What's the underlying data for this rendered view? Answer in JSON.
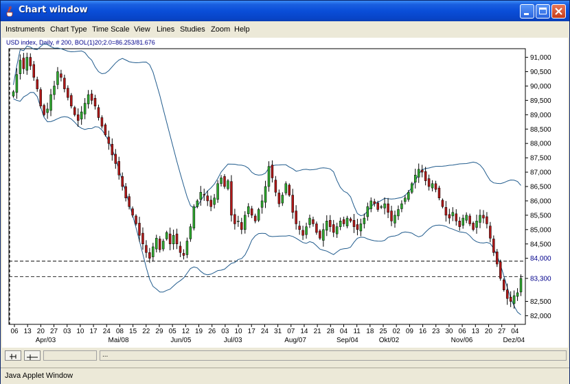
{
  "window": {
    "title": "Chart window",
    "status_text": "Java Applet Window"
  },
  "menu": {
    "items": [
      "Instruments",
      "Chart Type",
      "Time Scale",
      "View",
      "Lines",
      "Studies",
      "Zoom",
      "Help"
    ]
  },
  "chart_header": {
    "instrument": "USD index",
    "label": "USD index, Daily, # 200, BOL(1)20;2.0=86.253/81.676"
  },
  "status_bar": {
    "field2_text": "..."
  },
  "colors": {
    "up_candle": "#2ea82e",
    "down_candle": "#b01818",
    "bands": "#1f5a8c",
    "axis_text_blue": "#00008b",
    "title_gradient": "#0a4ed8"
  },
  "chart_data": {
    "type": "candlestick",
    "title": "USD index, Daily, # 200, BOL(1)20;2.0=86.253/81.676",
    "ylim": [
      81700,
      91300
    ],
    "y_ticks": [
      91000,
      90500,
      90000,
      89500,
      89000,
      88500,
      88000,
      87500,
      87000,
      86500,
      86000,
      85500,
      85000,
      84500,
      84000,
      83300,
      82500,
      82000
    ],
    "y_tick_labels": [
      "91,000",
      "90,500",
      "90,000",
      "89,500",
      "89,000",
      "88,500",
      "88,000",
      "87,500",
      "87,000",
      "86,500",
      "86,000",
      "85,500",
      "85,000",
      "84,500",
      "84,000",
      "83,300",
      "82,500",
      "82,000"
    ],
    "x_tick_labels": [
      "06",
      "13",
      "20",
      "27",
      "03",
      "10",
      "17",
      "24",
      "08",
      "15",
      "22",
      "29",
      "05",
      "12",
      "19",
      "26",
      "03",
      "10",
      "17",
      "24",
      "31",
      "07",
      "14",
      "21",
      "28",
      "04",
      "11",
      "18",
      "25",
      "02",
      "09",
      "16",
      "23",
      "30",
      "06",
      "13",
      "20",
      "27",
      "04"
    ],
    "month_labels": [
      "Apr/03",
      "Mai/08",
      "Jun/05",
      "Jul/03",
      "Aug/07",
      "Sep/04",
      "Okt/02",
      "Nov/06",
      "Dez/04"
    ],
    "horizontal_lines": [
      83900,
      83360
    ],
    "bollinger": {
      "period": 20,
      "std": 2.0,
      "upper_last": 86253,
      "lower_last": 81676
    },
    "close": [
      89800,
      90400,
      90900,
      90600,
      91000,
      90700,
      90300,
      89900,
      89300,
      89000,
      89200,
      89700,
      90000,
      90500,
      90300,
      89900,
      89600,
      89300,
      89000,
      88800,
      89100,
      89400,
      89700,
      89500,
      89300,
      88900,
      88600,
      88300,
      88000,
      87600,
      87300,
      86900,
      86500,
      86100,
      85800,
      85500,
      85200,
      84800,
      84500,
      84200,
      84000,
      84400,
      84700,
      84300,
      84600,
      84900,
      84500,
      84800,
      84500,
      84200,
      84100,
      84600,
      85100,
      85800,
      86000,
      86300,
      86200,
      86000,
      85800,
      86100,
      86600,
      86800,
      86500,
      86700,
      85500,
      85200,
      85300,
      85000,
      85500,
      85800,
      85500,
      85300,
      85700,
      86000,
      86500,
      87200,
      86800,
      86300,
      85900,
      86200,
      86600,
      86200,
      85600,
      85200,
      85000,
      84800,
      85100,
      85400,
      85200,
      84900,
      84700,
      85000,
      85300,
      85100,
      84900,
      85100,
      85300,
      85200,
      85400,
      85300,
      85100,
      85000,
      85200,
      85400,
      85800,
      86000,
      85900,
      85700,
      85800,
      85900,
      85600,
      85300,
      85500,
      85700,
      85900,
      86100,
      86300,
      86600,
      86900,
      87100,
      87000,
      86700,
      86500,
      86600,
      86400,
      86100,
      85800,
      85500,
      85400,
      85600,
      85300,
      85100,
      85400,
      85500,
      85200,
      85000,
      85300,
      85500,
      85400,
      85200,
      84700,
      84200,
      83800,
      83300,
      82900,
      82600,
      82500,
      82700,
      82800,
      83300
    ]
  }
}
